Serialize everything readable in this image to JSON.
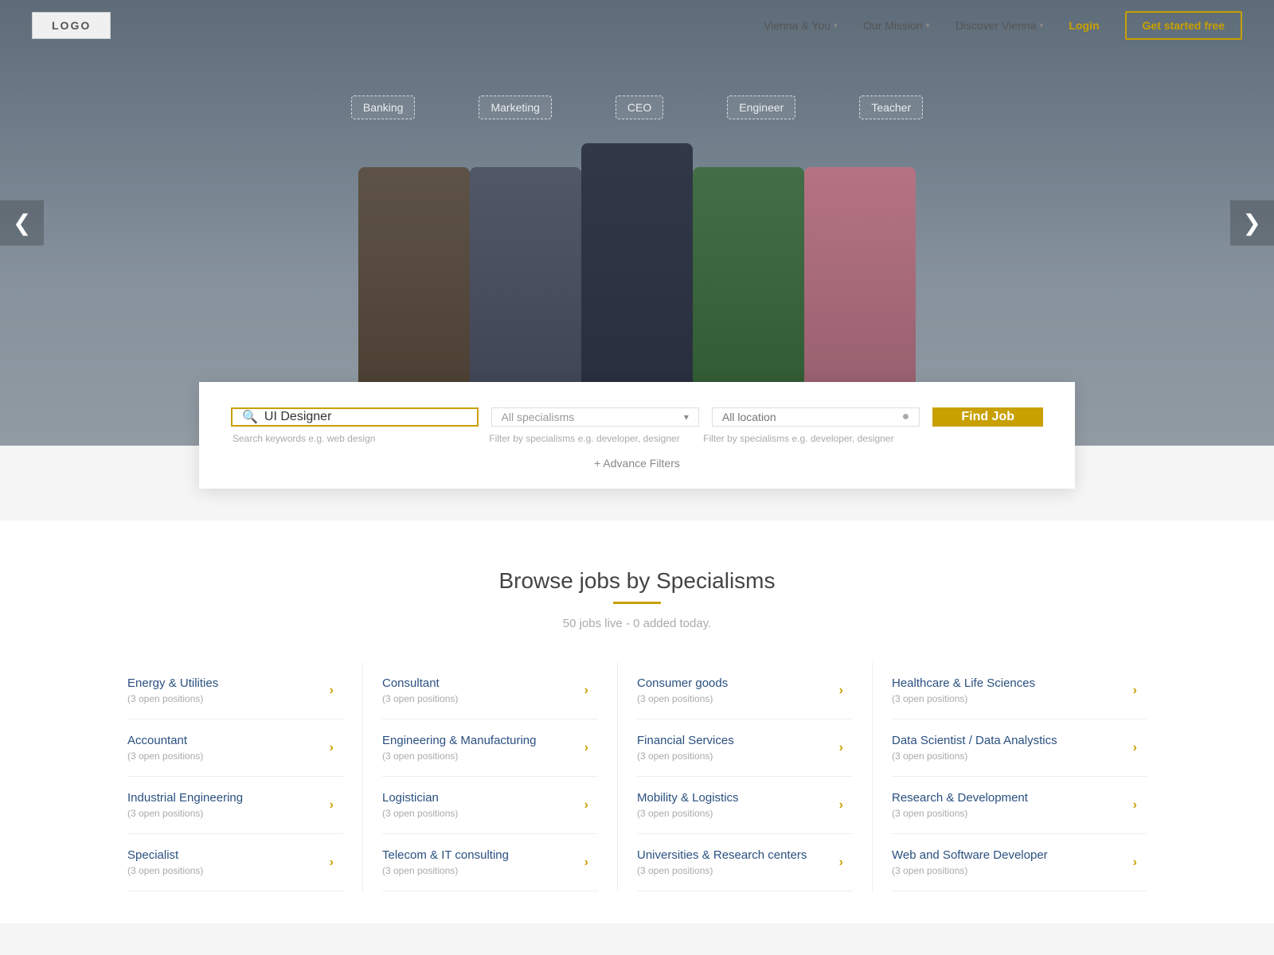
{
  "navbar": {
    "logo": "LOGO",
    "links": [
      {
        "label": "Vienna & You",
        "arrow": "▾"
      },
      {
        "label": "Our Mission",
        "arrow": "▾"
      },
      {
        "label": "Discover Vienna",
        "arrow": "▾"
      }
    ],
    "login": "Login",
    "cta": "Get started free"
  },
  "hero": {
    "prev": "❮",
    "next": "❯",
    "bubbles": [
      {
        "label": "Banking"
      },
      {
        "label": "Marketing"
      },
      {
        "label": "CEO"
      },
      {
        "label": "Engineer"
      },
      {
        "label": "Teacher"
      }
    ]
  },
  "search": {
    "keyword_placeholder": "UI Designer",
    "keyword_hint": "Search keywords e.g. web design",
    "specialism_placeholder": "All specialisms",
    "specialism_hint": "Filter by specialisms e.g. developer, designer",
    "location_placeholder": "All location",
    "location_hint": "Filter by specialisms e.g. developer, designer",
    "find_btn": "Find Job",
    "advance_filters": "+ Advance Filters"
  },
  "browse": {
    "title": "Browse jobs by Specialisms",
    "subtitle": "50 jobs live - 0 added today.",
    "jobs_grid": [
      [
        {
          "title": "Energy & Utilities",
          "count": "(3 open positions)"
        },
        {
          "title": "Accountant",
          "count": "(3 open positions)"
        },
        {
          "title": "Industrial Engineering",
          "count": "(3 open positions)"
        },
        {
          "title": "Specialist",
          "count": "(3 open positions)"
        }
      ],
      [
        {
          "title": "Consultant",
          "count": "(3 open positions)"
        },
        {
          "title": "Engineering & Manufacturing",
          "count": "(3 open positions)"
        },
        {
          "title": "Logistician",
          "count": "(3 open positions)"
        },
        {
          "title": "Telecom & IT consulting",
          "count": "(3 open positions)"
        }
      ],
      [
        {
          "title": "Consumer goods",
          "count": "(3 open positions)"
        },
        {
          "title": "Financial Services",
          "count": "(3 open positions)"
        },
        {
          "title": "Mobility & Logistics",
          "count": "(3 open positions)"
        },
        {
          "title": "Universities & Research centers",
          "count": "(3 open positions)"
        }
      ],
      [
        {
          "title": "Healthcare & Life Sciences",
          "count": "(3 open positions)"
        },
        {
          "title": "Data Scientist / Data Analystics",
          "count": "(3 open positions)"
        },
        {
          "title": "Research & Development",
          "count": "(3 open positions)"
        },
        {
          "title": "Web and Software Developer",
          "count": "(3 open positions)"
        }
      ]
    ]
  }
}
